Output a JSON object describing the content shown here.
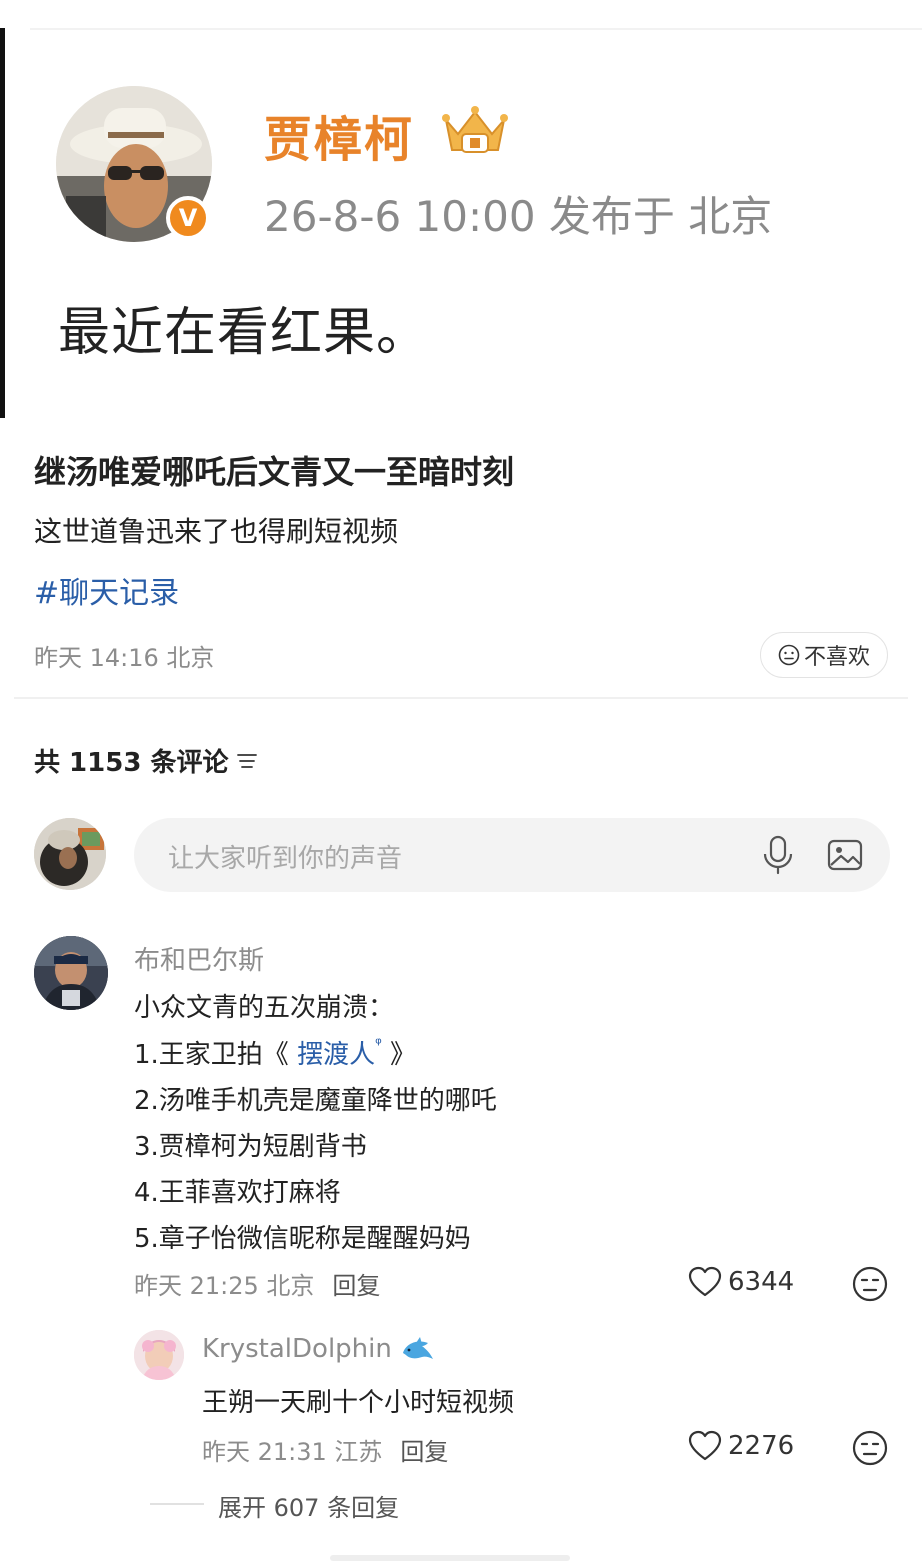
{
  "screenshot_card": {
    "user_name": "贾樟柯",
    "time_location": "26-8-6 10:00  发布于 北京",
    "text": "最近在看红果。"
  },
  "post": {
    "title": "继汤唯爱哪吒后文青又一至暗时刻",
    "subtitle": "这世道鲁迅来了也得刷短视频",
    "hashtag": "#聊天记录",
    "meta": "昨天 14:16 北京",
    "dislike_label": "不喜欢"
  },
  "comments_header": {
    "count_label": "共 1153 条评论"
  },
  "comment_input": {
    "placeholder": "让大家听到你的声音"
  },
  "comments": [
    {
      "user": "布和巴尔斯",
      "lines": [
        "小众文青的五次崩溃：",
        "1.王家卫拍《",
        "摆渡人",
        "》",
        "2.汤唯手机壳是魔童降世的哪吒",
        "3.贾樟柯为短剧背书",
        "4.王菲喜欢打麻将",
        "5.章子怡微信昵称是醒醒妈妈"
      ],
      "meta": "昨天 21:25 北京",
      "reply_label": "回复",
      "likes": "6344",
      "reply": {
        "user": "KrystalDolphin",
        "text": "王朔一天刷十个小时短视频",
        "meta": "昨天 21:31 江苏",
        "reply_label": "回复",
        "likes": "2276"
      },
      "expand_label": "展开 607 条回复"
    }
  ],
  "colors": {
    "link": "#2a5ea8",
    "accent_orange": "#e8832a",
    "meta_gray": "#8c8c8c"
  }
}
